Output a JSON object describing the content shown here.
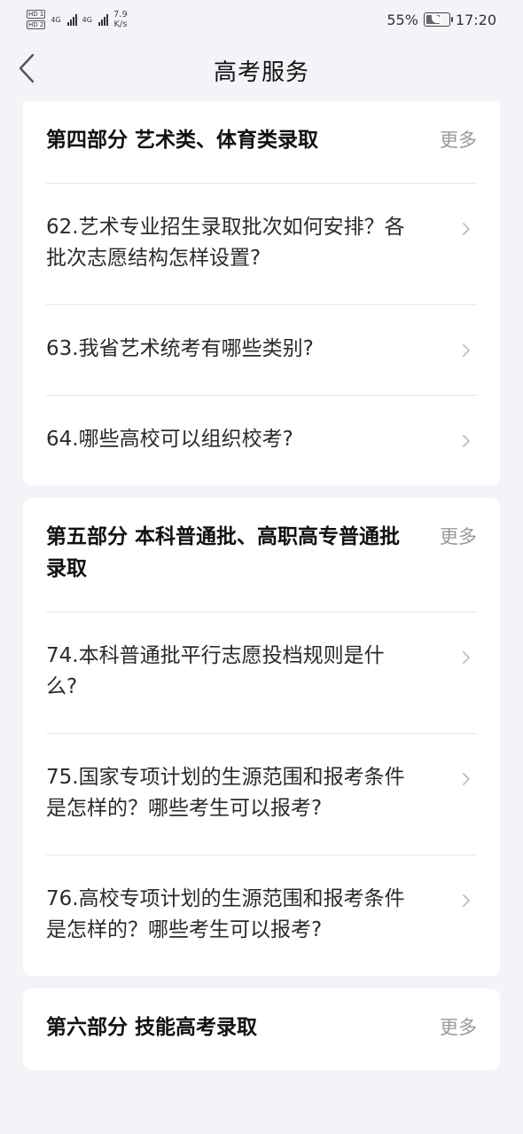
{
  "status_bar": {
    "sim1": "HD 1",
    "sim2": "HD 2",
    "net1": "4G",
    "net2": "4G",
    "speed_value": "7.9",
    "speed_unit": "K/s",
    "battery": "55%",
    "time": "17:20"
  },
  "header": {
    "title": "高考服务"
  },
  "sections": [
    {
      "title": "第四部分 艺术类、体育类录取",
      "more": "更多",
      "items": [
        "62.艺术专业招生录取批次如何安排？各批次志愿结构怎样设置?",
        "63.我省艺术统考有哪些类别?",
        "64.哪些高校可以组织校考?"
      ]
    },
    {
      "title": "第五部分 本科普通批、高职高专普通批录取",
      "more": "更多",
      "items": [
        "74.本科普通批平行志愿投档规则是什么?",
        "75.国家专项计划的生源范围和报考条件是怎样的？哪些考生可以报考?",
        "76.高校专项计划的生源范围和报考条件是怎样的？哪些考生可以报考?"
      ]
    },
    {
      "title": "第六部分 技能高考录取",
      "more": "更多",
      "items": []
    }
  ]
}
